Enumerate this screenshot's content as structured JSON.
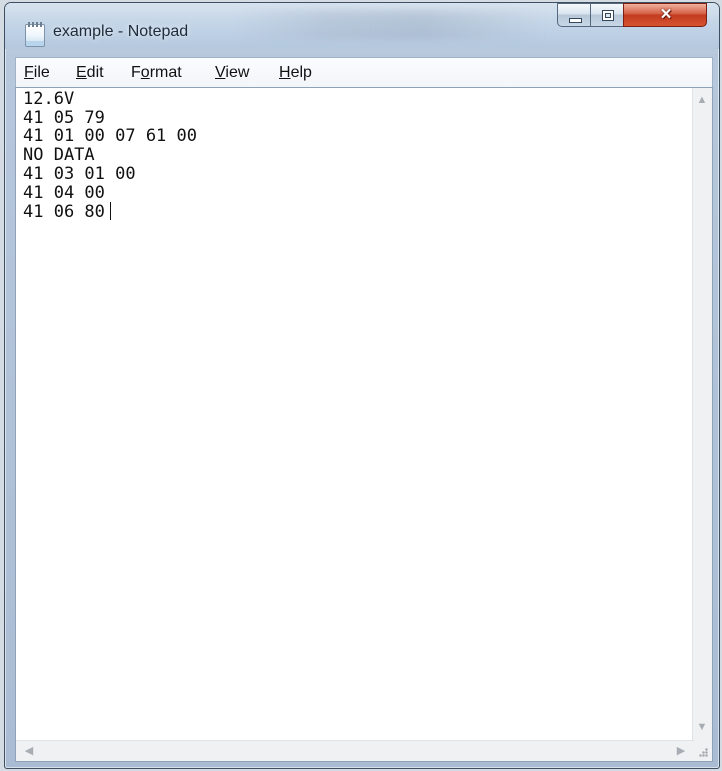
{
  "window": {
    "title": "example - Notepad"
  },
  "icons": {
    "app": "notepad-icon",
    "minimize": "minimize-icon",
    "maximize": "maximize-icon",
    "close": "close-icon",
    "scroll_up": "arrow-up-icon",
    "scroll_down": "arrow-down-icon",
    "scroll_left": "arrow-left-icon",
    "scroll_right": "arrow-right-icon",
    "size_grip": "resize-grip-icon"
  },
  "menu": {
    "file": {
      "mnemonic": "F",
      "rest": "ile"
    },
    "edit": {
      "mnemonic": "E",
      "rest": "dit"
    },
    "format": {
      "prefix": "F",
      "mnemonic": "o",
      "rest": "rmat"
    },
    "view": {
      "mnemonic": "V",
      "rest": "iew"
    },
    "help": {
      "mnemonic": "H",
      "rest": "elp"
    }
  },
  "editor": {
    "lines": [
      "12.6V",
      "41 05 79",
      "41 01 00 07 61 00",
      "NO DATA",
      "41 03 01 00",
      "41 04 00",
      "41 06 80"
    ]
  },
  "colors": {
    "titlebar": "#c5d6e8",
    "close_button": "#c23b20",
    "editor_background": "#ffffff",
    "text": "#111111"
  }
}
